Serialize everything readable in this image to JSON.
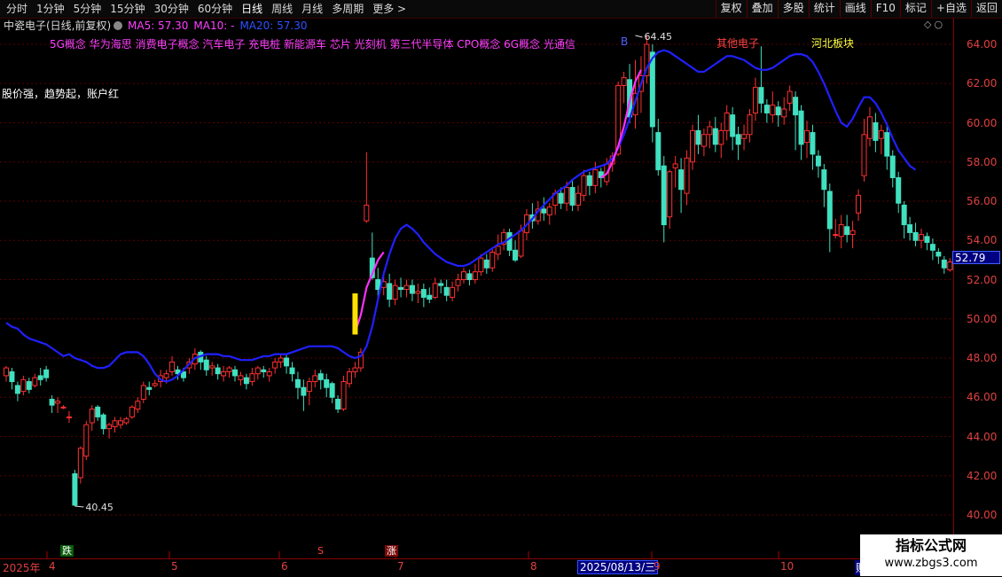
{
  "toolbar": {
    "periods": [
      "分时",
      "1分钟",
      "5分钟",
      "15分钟",
      "30分钟",
      "60分钟",
      "日线",
      "周线",
      "月线",
      "多周期",
      "更多 >"
    ],
    "active_period": "日线",
    "right_buttons": [
      "复权",
      "叠加",
      "多股",
      "统计",
      "画线",
      "F10",
      "标记",
      "+自选",
      "返回"
    ]
  },
  "title": {
    "stock": "中瓷电子(日线,前复权)",
    "ma5": "MA5: 57.30",
    "ma10": "MA10: -",
    "ma20": "MA20: 57.30"
  },
  "concepts": "5G概念 华为海思 消费电子概念 汽车电子 充电桩 新能源车 芯片 光刻机 第三代半导体 CPO概念 6G概念 光通信",
  "note": "股价强，趋势起，账户红",
  "labels": {
    "b": "B",
    "other": "其他电子",
    "hebei": "河北板块",
    "high": "64.45",
    "low": "40.45"
  },
  "price_axis": {
    "ticks": [
      "64.00",
      "62.00",
      "60.00",
      "58.00",
      "56.00",
      "54.00",
      "52.00",
      "50.00",
      "48.00",
      "46.00",
      "44.00",
      "42.00",
      "40.00"
    ],
    "current": "52.79"
  },
  "date_axis": {
    "year": "2025年",
    "months": [
      "4",
      "5",
      "6",
      "7",
      "8",
      "9",
      "10"
    ],
    "cursor": "2025/08/13/三",
    "right_mark": "账"
  },
  "markers": {
    "die": "跌",
    "s": "S",
    "zhang": "涨"
  },
  "watermark": {
    "line1": "指标公式网",
    "line2": "www.zbgs3.com"
  },
  "colors": {
    "up": "#ff3030",
    "down": "#40e0c0",
    "ma20": "#2020ff",
    "pink": "#ff30ff",
    "yellow": "#ffe000"
  },
  "chart_data": {
    "type": "candlestick",
    "ylim": [
      40,
      64.5
    ],
    "candles": [
      [
        47.1,
        47.5,
        46.8,
        47.6
      ],
      [
        47.3,
        46.8,
        46.4,
        47.5
      ],
      [
        46.6,
        46.2,
        45.8,
        46.8
      ],
      [
        46.3,
        46.9,
        46.1,
        47.1
      ],
      [
        46.8,
        46.4,
        46.2,
        47.0
      ],
      [
        46.6,
        47.0,
        46.5,
        47.2
      ],
      [
        47.1,
        46.9,
        46.6,
        47.5
      ],
      [
        47.4,
        47.0,
        46.8,
        47.6
      ],
      [
        45.9,
        45.6,
        45.2,
        46.1
      ],
      [
        45.7,
        45.8,
        45.2,
        46.0
      ],
      [
        45.5,
        45.5,
        45.4,
        45.6
      ],
      [
        45.0,
        45.0,
        44.7,
        45.3
      ],
      [
        42.1,
        40.5,
        40.45,
        42.3
      ],
      [
        41.9,
        43.4,
        41.6,
        43.5
      ],
      [
        43.0,
        44.6,
        42.8,
        44.8
      ],
      [
        44.7,
        45.4,
        44.3,
        45.6
      ],
      [
        45.5,
        45.0,
        44.8,
        45.6
      ],
      [
        45.1,
        44.4,
        44.1,
        45.2
      ],
      [
        44.4,
        44.6,
        43.9,
        44.7
      ],
      [
        44.5,
        44.8,
        44.2,
        45.0
      ],
      [
        44.6,
        44.8,
        44.4,
        45.0
      ],
      [
        44.7,
        44.9,
        44.6,
        45.0
      ],
      [
        45.0,
        45.5,
        44.9,
        45.6
      ],
      [
        45.4,
        45.8,
        45.2,
        46.0
      ],
      [
        45.9,
        46.6,
        45.7,
        46.8
      ],
      [
        46.5,
        46.4,
        46.1,
        46.8
      ],
      [
        46.6,
        46.7,
        46.5,
        46.9
      ],
      [
        46.8,
        47.1,
        46.5,
        47.4
      ],
      [
        47.0,
        47.2,
        46.7,
        47.4
      ],
      [
        47.3,
        47.8,
        47.1,
        48.1
      ],
      [
        47.4,
        47.2,
        46.9,
        47.6
      ],
      [
        47.3,
        47.0,
        46.8,
        47.5
      ],
      [
        47.5,
        47.8,
        47.2,
        48.0
      ],
      [
        47.7,
        48.2,
        47.4,
        48.5
      ],
      [
        48.3,
        47.8,
        47.4,
        48.4
      ],
      [
        47.9,
        47.4,
        47.1,
        48.1
      ],
      [
        47.5,
        47.6,
        47.1,
        47.8
      ],
      [
        47.5,
        47.2,
        46.9,
        47.7
      ],
      [
        47.1,
        47.3,
        46.8,
        47.6
      ],
      [
        47.3,
        47.5,
        47.0,
        47.6
      ],
      [
        47.4,
        47.1,
        46.8,
        47.6
      ],
      [
        46.9,
        47.1,
        46.6,
        47.3
      ],
      [
        47.0,
        46.7,
        46.4,
        47.2
      ],
      [
        46.8,
        47.2,
        46.6,
        47.5
      ],
      [
        47.2,
        47.5,
        46.9,
        47.6
      ],
      [
        47.4,
        47.3,
        47.0,
        47.6
      ],
      [
        47.1,
        47.3,
        46.8,
        47.5
      ],
      [
        47.5,
        47.8,
        47.2,
        48.0
      ],
      [
        47.8,
        48.0,
        47.5,
        48.2
      ],
      [
        48.0,
        47.6,
        47.2,
        48.2
      ],
      [
        47.5,
        47.2,
        46.8,
        47.8
      ],
      [
        46.9,
        46.5,
        45.9,
        47.3
      ],
      [
        46.5,
        46.1,
        45.3,
        46.9
      ],
      [
        46.3,
        46.8,
        45.6,
        47.0
      ],
      [
        46.8,
        47.1,
        46.5,
        47.4
      ],
      [
        47.2,
        46.9,
        46.4,
        47.4
      ],
      [
        46.9,
        46.5,
        46.0,
        47.2
      ],
      [
        46.7,
        46.0,
        45.7,
        46.8
      ],
      [
        45.9,
        45.4,
        45.2,
        46.1
      ],
      [
        45.4,
        46.8,
        45.3,
        47.1
      ],
      [
        46.7,
        47.3,
        46.5,
        47.5
      ],
      [
        47.3,
        47.5,
        47.0,
        47.8
      ],
      [
        47.5,
        48.3,
        47.3,
        48.5
      ],
      [
        55.0,
        55.8,
        54.9,
        58.5
      ],
      [
        53.1,
        52.1,
        52.0,
        54.4
      ],
      [
        52.0,
        51.5,
        51.0,
        52.6
      ],
      [
        51.6,
        51.9,
        51.2,
        52.2
      ],
      [
        51.8,
        51.0,
        50.6,
        52.3
      ],
      [
        51.0,
        51.7,
        50.7,
        52.0
      ],
      [
        51.6,
        51.5,
        51.1,
        52.1
      ],
      [
        51.5,
        51.7,
        51.1,
        52.0
      ],
      [
        51.7,
        51.3,
        50.9,
        52.0
      ],
      [
        51.3,
        51.4,
        50.8,
        51.8
      ],
      [
        51.5,
        51.1,
        50.6,
        51.8
      ],
      [
        51.2,
        51.0,
        50.8,
        51.6
      ],
      [
        51.1,
        51.8,
        51.0,
        52.1
      ],
      [
        51.8,
        51.7,
        51.3,
        52.0
      ],
      [
        51.6,
        51.2,
        50.9,
        52.0
      ],
      [
        51.1,
        51.6,
        50.9,
        51.9
      ],
      [
        51.7,
        52.0,
        51.4,
        52.3
      ],
      [
        52.0,
        52.4,
        51.8,
        52.6
      ],
      [
        52.3,
        52.0,
        51.7,
        52.5
      ],
      [
        52.0,
        52.4,
        51.8,
        52.8
      ],
      [
        52.4,
        53.1,
        52.2,
        53.3
      ],
      [
        53.0,
        52.6,
        52.3,
        53.3
      ],
      [
        52.6,
        53.4,
        52.4,
        53.6
      ],
      [
        53.3,
        53.7,
        53.0,
        54.3
      ],
      [
        53.8,
        54.4,
        53.5,
        54.6
      ],
      [
        54.4,
        53.5,
        53.2,
        54.6
      ],
      [
        53.5,
        53.0,
        52.9,
        54.0
      ],
      [
        53.2,
        54.5,
        53.1,
        54.8
      ],
      [
        54.4,
        55.3,
        54.0,
        55.6
      ],
      [
        55.3,
        55.0,
        54.6,
        55.9
      ],
      [
        55.0,
        55.6,
        54.8,
        56.0
      ],
      [
        55.6,
        55.4,
        55.0,
        56.2
      ],
      [
        55.3,
        55.7,
        54.8,
        55.9
      ],
      [
        55.8,
        56.4,
        55.3,
        56.6
      ],
      [
        56.4,
        55.9,
        55.6,
        56.7
      ],
      [
        55.9,
        56.7,
        55.5,
        57.0
      ],
      [
        56.7,
        55.8,
        55.5,
        57.1
      ],
      [
        55.8,
        56.4,
        55.5,
        56.8
      ],
      [
        56.3,
        57.3,
        56.0,
        57.6
      ],
      [
        57.3,
        56.8,
        56.3,
        57.5
      ],
      [
        56.8,
        57.6,
        56.4,
        58.0
      ],
      [
        57.5,
        57.2,
        56.7,
        57.7
      ],
      [
        57.0,
        57.9,
        56.8,
        58.2
      ],
      [
        57.9,
        58.3,
        57.5,
        58.5
      ],
      [
        58.4,
        61.9,
        58.3,
        62.1
      ],
      [
        61.9,
        62.3,
        61.0,
        62.6
      ],
      [
        62.2,
        60.3,
        60.0,
        63.0
      ],
      [
        60.4,
        61.5,
        59.7,
        63.2
      ],
      [
        61.6,
        62.4,
        60.5,
        63.4
      ],
      [
        62.4,
        64.0,
        62.0,
        64.45
      ],
      [
        63.6,
        59.8,
        59.0,
        64.0
      ],
      [
        59.5,
        57.6,
        57.3,
        60.2
      ],
      [
        57.8,
        54.8,
        53.9,
        58.3
      ],
      [
        55.2,
        57.5,
        54.6,
        57.6
      ],
      [
        57.7,
        57.9,
        56.7,
        58.3
      ],
      [
        57.6,
        56.6,
        55.4,
        58.2
      ],
      [
        56.4,
        58.2,
        55.8,
        58.6
      ],
      [
        58.0,
        59.6,
        57.6,
        59.9
      ],
      [
        59.6,
        58.9,
        58.4,
        60.4
      ],
      [
        58.8,
        59.4,
        58.3,
        59.7
      ],
      [
        59.4,
        59.8,
        58.7,
        60.1
      ],
      [
        59.7,
        58.9,
        58.5,
        60.3
      ],
      [
        58.9,
        59.6,
        58.2,
        60.0
      ],
      [
        59.6,
        60.5,
        59.1,
        60.9
      ],
      [
        60.4,
        59.3,
        58.6,
        60.8
      ],
      [
        59.4,
        58.9,
        58.1,
        59.8
      ],
      [
        59.2,
        59.4,
        58.6,
        59.9
      ],
      [
        59.4,
        60.4,
        59.0,
        60.7
      ],
      [
        60.5,
        61.8,
        60.1,
        62.3
      ],
      [
        61.8,
        61.0,
        60.5,
        63.9
      ],
      [
        60.9,
        60.5,
        60.0,
        61.2
      ],
      [
        60.4,
        60.9,
        60.0,
        61.6
      ],
      [
        60.8,
        60.4,
        59.8,
        61.1
      ],
      [
        60.3,
        60.7,
        59.9,
        61.3
      ],
      [
        61.0,
        61.6,
        60.6,
        61.9
      ],
      [
        61.3,
        60.4,
        58.6,
        61.6
      ],
      [
        60.6,
        58.9,
        58.1,
        60.9
      ],
      [
        59.0,
        59.6,
        58.2,
        60.1
      ],
      [
        59.5,
        58.4,
        57.6,
        59.9
      ],
      [
        58.3,
        57.8,
        57.2,
        58.6
      ],
      [
        57.6,
        56.6,
        55.7,
        57.9
      ],
      [
        56.5,
        54.6,
        53.4,
        56.9
      ],
      [
        54.3,
        54.3,
        54.1,
        55.1
      ],
      [
        54.2,
        54.8,
        53.6,
        55.3
      ],
      [
        54.7,
        54.3,
        53.9,
        55.3
      ],
      [
        54.3,
        54.5,
        53.6,
        55.0
      ],
      [
        55.4,
        56.3,
        55.0,
        56.6
      ],
      [
        57.3,
        59.4,
        57.0,
        60.2
      ],
      [
        59.2,
        60.3,
        58.8,
        60.8
      ],
      [
        60.0,
        59.1,
        58.5,
        60.5
      ],
      [
        59.2,
        59.6,
        58.4,
        59.9
      ],
      [
        59.5,
        58.3,
        57.6,
        59.9
      ],
      [
        58.3,
        57.2,
        56.7,
        58.6
      ],
      [
        57.2,
        55.9,
        55.4,
        57.5
      ],
      [
        55.8,
        54.8,
        54.1,
        56.0
      ],
      [
        54.8,
        54.4,
        54.0,
        55.2
      ],
      [
        54.4,
        54.0,
        53.7,
        54.9
      ],
      [
        54.0,
        54.3,
        53.6,
        54.6
      ],
      [
        54.2,
        53.9,
        53.5,
        54.4
      ],
      [
        53.8,
        53.5,
        53.0,
        54.1
      ],
      [
        53.4,
        53.2,
        52.8,
        53.6
      ],
      [
        53.0,
        52.6,
        52.3,
        53.2
      ],
      [
        52.5,
        52.9,
        52.4,
        53.1
      ],
      [
        52.9,
        52.5,
        52.4,
        53.2
      ]
    ],
    "ma20": [
      49.8,
      49.6,
      49.5,
      49.2,
      49.0,
      48.9,
      48.8,
      48.7,
      48.5,
      48.3,
      48.1,
      48.2,
      48.0,
      47.9,
      47.8,
      47.6,
      47.5,
      47.5,
      47.6,
      47.9,
      48.2,
      48.3,
      48.3,
      48.3,
      48.1,
      47.7,
      47.2,
      46.9,
      46.8,
      46.9,
      47.1,
      47.4,
      47.7,
      48.0,
      48.1,
      48.2,
      48.2,
      48.2,
      48.1,
      48.1,
      48.0,
      47.9,
      47.9,
      47.9,
      48.0,
      48.1,
      48.1,
      48.2,
      48.2,
      48.2,
      48.3,
      48.4,
      48.5,
      48.6,
      48.6,
      48.6,
      48.6,
      48.6,
      48.5,
      48.3,
      48.1,
      48.0,
      48.1,
      48.6,
      49.6,
      51.0,
      52.3,
      53.3,
      54.1,
      54.6,
      54.8,
      54.6,
      54.3,
      53.9,
      53.6,
      53.3,
      53.1,
      52.9,
      52.8,
      52.7,
      52.7,
      52.8,
      53.0,
      53.2,
      53.4,
      53.6,
      53.8,
      53.9,
      54.1,
      54.3,
      54.5,
      54.8,
      55.1,
      55.5,
      55.8,
      56.1,
      56.4,
      56.6,
      56.8,
      57.1,
      57.3,
      57.5,
      57.6,
      57.7,
      57.8,
      57.9,
      58.2,
      58.7,
      59.4,
      60.2,
      61.1,
      62.0,
      62.8,
      63.3,
      63.6,
      63.7,
      63.6,
      63.4,
      63.2,
      63.0,
      62.8,
      62.6,
      62.6,
      62.8,
      63.0,
      63.2,
      63.4,
      63.4,
      63.3,
      63.2,
      63.0,
      62.8,
      62.7,
      62.7,
      62.8,
      63.0,
      63.2,
      63.4,
      63.5,
      63.5,
      63.4,
      63.1,
      62.6,
      62.0,
      61.3,
      60.6,
      60.0,
      59.8,
      60.2,
      60.8,
      61.3,
      61.3,
      61.0,
      60.5,
      59.9,
      59.2,
      58.6,
      58.2,
      57.8,
      57.6
    ],
    "pink_segment": [
      [
        61,
        49.3
      ],
      [
        62,
        50.2
      ],
      [
        63,
        51.6
      ],
      [
        64,
        52.3
      ],
      [
        65,
        53.0
      ],
      [
        66,
        53.4
      ]
    ],
    "pink_segment2": [
      [
        104,
        57.2
      ],
      [
        105,
        57.4
      ],
      [
        106,
        58.0
      ],
      [
        107,
        58.8
      ],
      [
        108,
        59.8
      ],
      [
        109,
        61.1
      ],
      [
        110,
        62.1
      ],
      [
        111,
        62.7
      ]
    ],
    "yellow_bar": {
      "from": 49.2,
      "to": 51.3
    }
  }
}
